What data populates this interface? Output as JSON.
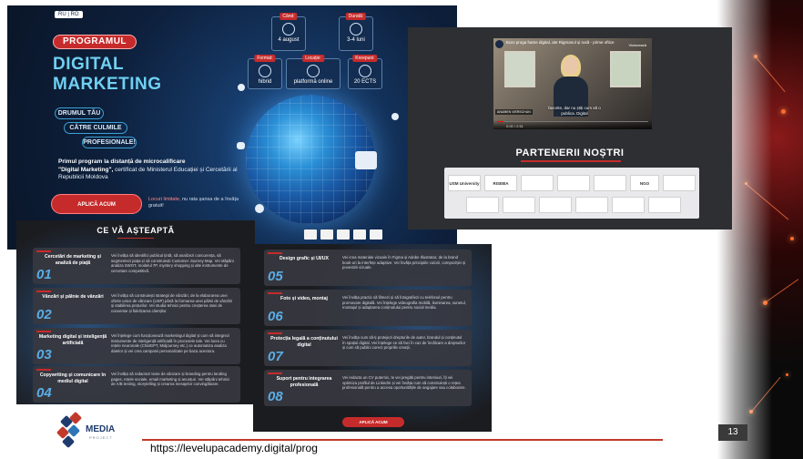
{
  "banner": {
    "lang": "RU | RO",
    "program_label": "PROGRAMUL",
    "title_line1": "DIGITAL",
    "title_line2": "MARKETING",
    "tag1": "DRUMUL TĂU",
    "tag2": "CĂTRE CULMILE",
    "tag3": "PROFESIONALE!",
    "intro_bold1": "Primul program la distanță de microcalificare",
    "intro_bold2": "\"Digital Marketing\",",
    "intro_rest": " certificat de Ministerul Educației și Cercetării al Republicii Moldova",
    "apply_button": "APLICĂ ACUM",
    "apply_note_red": "Locuri limitate,",
    "apply_note_rest": " nu rata șansa de a învăța gratuit!",
    "cards": [
      {
        "header": "Când:",
        "value": "4 august"
      },
      {
        "header": "Durată:",
        "value": "3-4 luni"
      },
      {
        "header": "Format:",
        "value": "hibrid"
      },
      {
        "header": "Locație:",
        "value": "platformă online"
      },
      {
        "header": "Kreepuni:",
        "value": "20 ECTS"
      }
    ]
  },
  "video": {
    "title": "Euro proga hame digital, ate Rigmanul și rusă - prime oftice",
    "watch_later": "Vizionează",
    "subtitle_line1": "favorite, dar nu știți cum să o",
    "subtitle_line2": "publica. Digital",
    "speaker_tag": "ANUMEN VIERSCHUN",
    "time": "0:00 / 2:51"
  },
  "partners": {
    "title": "PARTENERII NOȘTRI",
    "logos": [
      "USM University",
      "RISEBA",
      "",
      "",
      "",
      "NGO",
      "",
      "",
      "",
      "",
      "",
      "",
      ""
    ]
  },
  "services_left": {
    "title": "CE VĂ AȘTEAPTĂ",
    "items": [
      {
        "num": "01",
        "name": "Cercetări de marketing și analiză de piață",
        "desc": "Vei învăța să identifici publicul țintă, să analizezi concurența, să segmentezi piața și să construiești Customer Journey Map. Vei stăpâni analiza SWOT, modelul 7P, mystery shopping și alte instrumente de cercetare competitivă."
      },
      {
        "num": "02",
        "name": "Vânzări și pâlnie de vânzări",
        "desc": "Vei învăța să construiești strategii de vânzări, de la elaborarea unei oferte unice de vânzare (USP) până la formarea unei pâlnii de vânzări și stabilirea prețurilor. Vei studia tehnici pentru creșterea ratei de conversie și fidelizarea clienților."
      },
      {
        "num": "03",
        "name": "Marketing digital și inteligență artificială",
        "desc": "Vei înțelege cum funcționează marketingul digital și cum să integrezi instrumente de inteligență artificială în procesele tale. Vei lucra cu rețele neuronale (ChatGPT, Midjourney etc.) ce automatiza analiza datelor și vei crea campanii personalizate pe baza acestora."
      },
      {
        "num": "04",
        "name": "Copywriting și comunicare în mediul digital",
        "desc": "Vei învăța să redactezi texte de vânzare și branding pentru landing pages, rețele sociale, email marketing și anunțuri. Vei stăpâni tehnici de A/B testing, storytelling și crearea mesajelor convingătoare."
      }
    ]
  },
  "services_right": {
    "items": [
      {
        "num": "05",
        "name": "Design grafic și UI/UX",
        "desc": "Vei crea materiale vizuale în Figma și Adobe Illustrator, de la brand book-uri la interfețe adaptive. Vei învăța principiile culorii, compoziției și povestirii vizuale."
      },
      {
        "num": "06",
        "name": "Foto și video, montaj",
        "desc": "Vei învăța practic să filmezi și să fotografiezi cu telefonul pentru promovare digitală. Vei înțelege videografia mobilă, iluminarea, sunetul, montajul și adaptarea conținutului pentru social media."
      },
      {
        "num": "07",
        "name": "Protecția legală a conținutului digital",
        "desc": "Vei învăța cum să-ți protejezi drepturile de autor, brandul și conținutul în spațiul digital. Vei înțelege ce să faci în caz de încălcare a drepturilor și cum să publici corect propriile creații."
      },
      {
        "num": "08",
        "name": "Suport pentru integrarea profesională",
        "desc": "Vei redacta un CV puternic, te vei pregăti pentru interviuri, îți vei optimiza profilul de LinkedIn și vei învăța cum să construiești o rețea profesională pentru a accesa oportunitățile de angajare sau colaborare."
      }
    ],
    "apply_button": "APLICĂ ACUM"
  },
  "footer": {
    "logo_word": "MEDIA",
    "logo_sub": "PROJECT",
    "url": "https://levelupacademy.digital/prog",
    "page": "13"
  },
  "colors": {
    "accent": "#c62b2b",
    "title_cyan": "#6fd0f2",
    "panel": "#2d2f33"
  }
}
